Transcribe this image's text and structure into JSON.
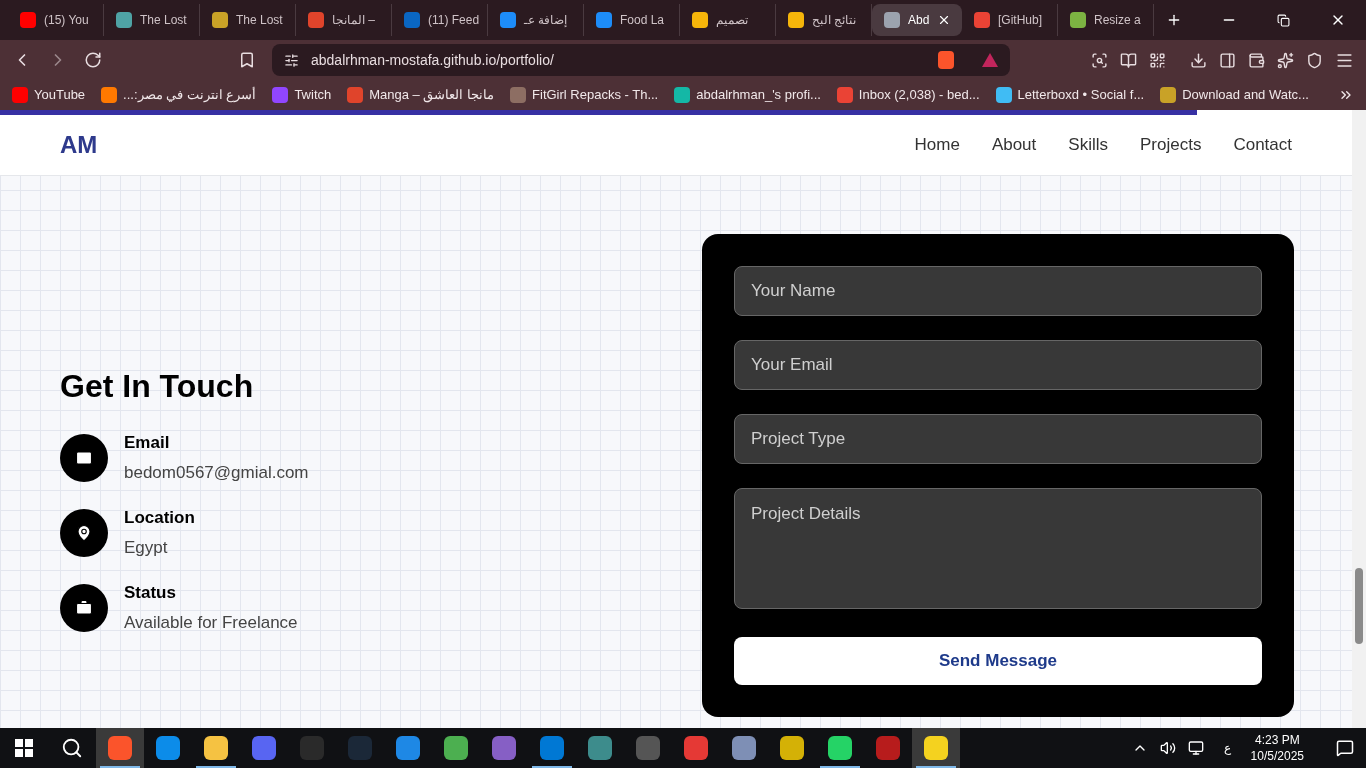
{
  "tabs": [
    {
      "title": "(15) You",
      "color": "#ff0000",
      "selected": false
    },
    {
      "title": "The Lost",
      "color": "#4fa3a5",
      "selected": false
    },
    {
      "title": "The Lost",
      "color": "#c9a227",
      "selected": false
    },
    {
      "title": "المانجا –",
      "color": "#e0442b",
      "selected": false
    },
    {
      "title": "(11) Feed",
      "color": "#0a66c2",
      "selected": false
    },
    {
      "title": "إضافة عـ",
      "color": "#1d8cf8",
      "selected": false
    },
    {
      "title": "Food La",
      "color": "#1d8cf8",
      "selected": false
    },
    {
      "title": "تصميم",
      "color": "#f5b50a",
      "selected": false
    },
    {
      "title": "نتائج البح",
      "color": "#f5b50a",
      "selected": false
    },
    {
      "title": "Abd",
      "color": "#9ca3af",
      "selected": true
    },
    {
      "title": "[GitHub]",
      "color": "#ea4335",
      "selected": false
    },
    {
      "title": "Resize a",
      "color": "#7cb342",
      "selected": false
    }
  ],
  "address": "abdalrhman-mostafa.github.io/portfolio/",
  "bookmarks": [
    {
      "title": "YouTube",
      "color": "#ff0000"
    },
    {
      "title": "أسرع انترنت في مصر:...",
      "color": "#ff7900"
    },
    {
      "title": "Twitch",
      "color": "#9146ff"
    },
    {
      "title": "Manga – مانجا العاشق",
      "color": "#e0442b"
    },
    {
      "title": "FitGirl Repacks - Th...",
      "color": "#8d6e63"
    },
    {
      "title": "abdalrhman_'s profi...",
      "color": "#14b8a6"
    },
    {
      "title": "Inbox (2,038) - bed...",
      "color": "#ea4335"
    },
    {
      "title": "Letterboxd • Social f...",
      "color": "#40bcf4"
    },
    {
      "title": "Download and Watc...",
      "color": "#c9a227"
    }
  ],
  "page": {
    "scroll_progress": {
      "level": 0.885
    },
    "logo": "AM",
    "nav": [
      {
        "label": "Home"
      },
      {
        "label": "About"
      },
      {
        "label": "Skills"
      },
      {
        "label": "Projects"
      },
      {
        "label": "Contact"
      }
    ],
    "contact": {
      "heading": "Get In Touch",
      "items": [
        {
          "kind": "email",
          "label": "Email",
          "value": "bedom0567@gmial.com"
        },
        {
          "kind": "location",
          "label": "Location",
          "value": "Egypt"
        },
        {
          "kind": "status",
          "label": "Status",
          "value": "Available for Freelance"
        }
      ],
      "form": {
        "fields": [
          {
            "kind": "input",
            "placeholder": "Your Name"
          },
          {
            "kind": "input",
            "placeholder": "Your Email"
          },
          {
            "kind": "input",
            "placeholder": "Project Type"
          },
          {
            "kind": "textarea",
            "placeholder": "Project Details"
          }
        ],
        "button": "Send Message"
      }
    }
  },
  "taskbar": {
    "apps": [
      {
        "color": "#fb542b",
        "running": true,
        "selected": true
      },
      {
        "color": "#0c8ce9",
        "running": false,
        "selected": false
      },
      {
        "color": "#f5c242",
        "running": true,
        "selected": false
      },
      {
        "color": "#5865f2",
        "running": false,
        "selected": false
      },
      {
        "color": "#2a2a2a",
        "running": false,
        "selected": false
      },
      {
        "color": "#1b2838",
        "running": false,
        "selected": false
      },
      {
        "color": "#1e88e5",
        "running": false,
        "selected": false
      },
      {
        "color": "#4caf50",
        "running": false,
        "selected": false
      },
      {
        "color": "#865fc5",
        "running": false,
        "selected": false
      },
      {
        "color": "#0078d4",
        "running": true,
        "selected": false
      },
      {
        "color": "#3d8c8c",
        "running": false,
        "selected": false
      },
      {
        "color": "#555555",
        "running": false,
        "selected": false
      },
      {
        "color": "#e53935",
        "running": false,
        "selected": false
      },
      {
        "color": "#7e8fb5",
        "running": false,
        "selected": false
      },
      {
        "color": "#d4b106",
        "running": false,
        "selected": false
      },
      {
        "color": "#25d366",
        "running": true,
        "selected": false
      },
      {
        "color": "#b71c1c",
        "running": false,
        "selected": false
      },
      {
        "color": "#f4d21f",
        "running": true,
        "selected": true
      }
    ],
    "language": "ع",
    "time": "4:23 PM",
    "date": "10/5/2025"
  }
}
